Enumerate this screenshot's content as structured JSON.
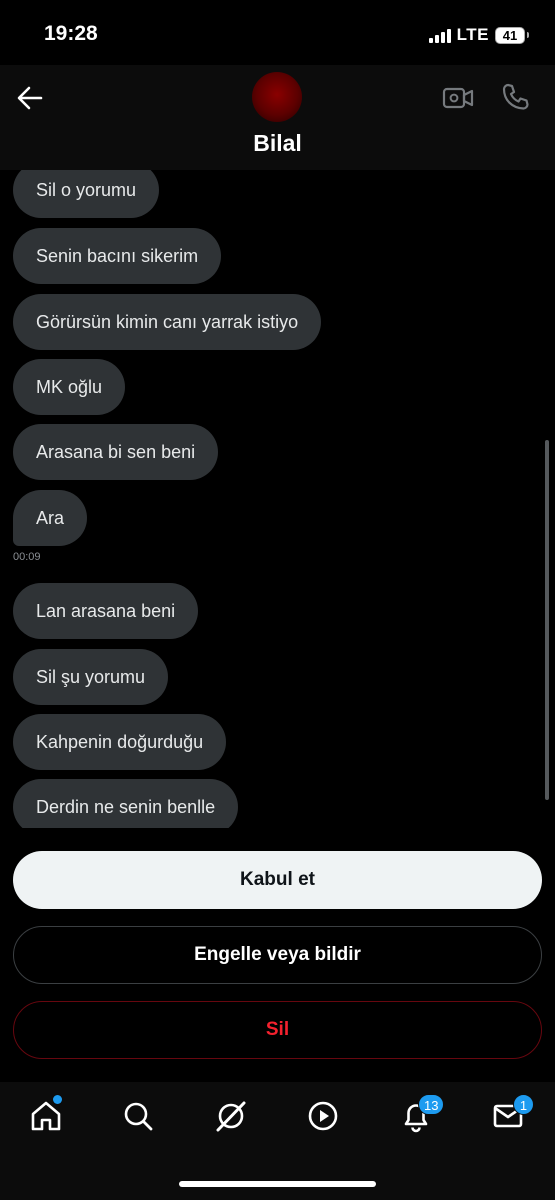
{
  "status_bar": {
    "time": "19:28",
    "network": "LTE",
    "battery": "41"
  },
  "header": {
    "contact_name": "Bilal"
  },
  "messages": [
    {
      "text": "Sil o yorumu"
    },
    {
      "text": "Senin bacını sikerim"
    },
    {
      "text": "Görürsün kimin canı yarrak istiyo"
    },
    {
      "text": "MK oğlu"
    },
    {
      "text": "Arasana bi sen beni"
    },
    {
      "text": "Ara",
      "time": "00:09"
    },
    {
      "text": "Lan arasana beni"
    },
    {
      "text": "Sil şu yorumu"
    },
    {
      "text": "Kahpenin doğurduğu"
    },
    {
      "text": "Derdin ne senin benlle"
    }
  ],
  "actions": {
    "accept": "Kabul et",
    "block_report": "Engelle veya bildir",
    "delete": "Sil"
  },
  "tabbar": {
    "notifications_badge": "13",
    "messages_badge": "1",
    "icons": [
      "home-icon",
      "search-icon",
      "grok-icon",
      "video-icon",
      "bell-icon",
      "mail-icon"
    ]
  },
  "colors": {
    "accent": "#1d9bf0",
    "bubble": "#2f3336",
    "danger": "#f4212e"
  }
}
